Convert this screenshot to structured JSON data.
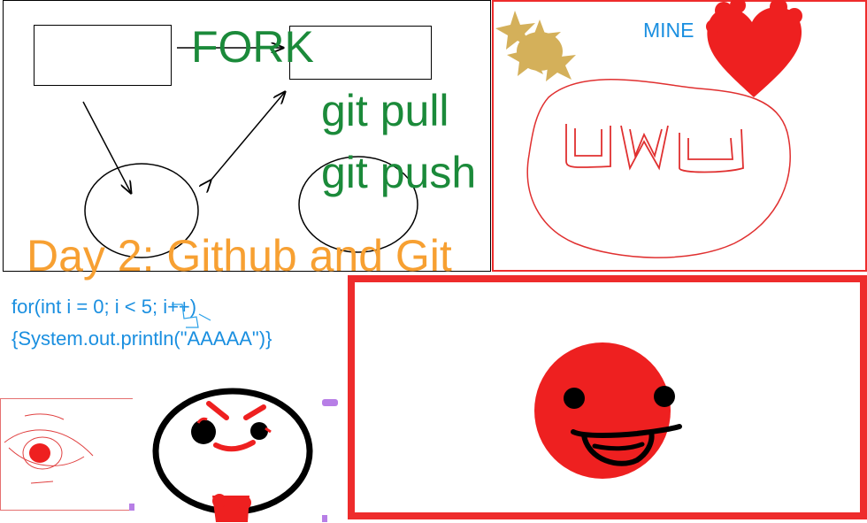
{
  "diagram": {
    "fork_label": "FORK",
    "git_pull_label": "git pull",
    "git_push_label": "git push"
  },
  "title": "Day 2: Github and Git",
  "uwu_panel": {
    "mine_label": "MINE",
    "face_text": "UWU"
  },
  "code": {
    "line1": "for(int i = 0; i < 5; i++)",
    "line2": "{System.out.println(\"AAAAA\")}"
  },
  "colors": {
    "green_text": "#1b8a3a",
    "orange_title": "#f7a032",
    "blue_text": "#1a8fe0",
    "red": "#ee2c2c",
    "gold": "#d4b05a",
    "purple": "#b77ee6"
  },
  "icons": [
    "star-scribble-icon",
    "heart-icon",
    "smiley-face-icon",
    "angry-face-icon",
    "eye-icon"
  ]
}
